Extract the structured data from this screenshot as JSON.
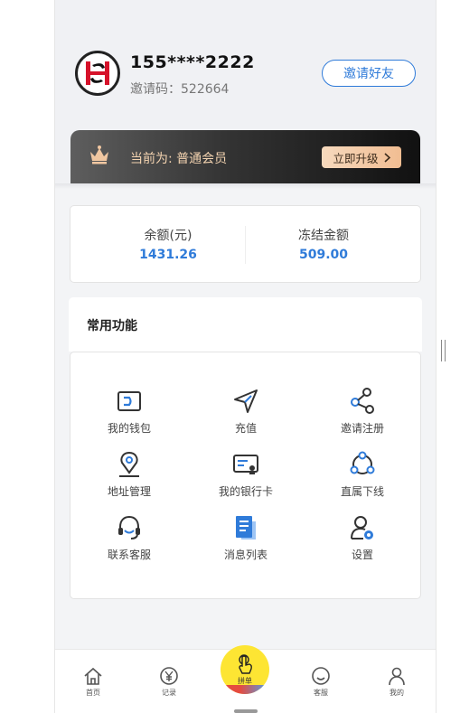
{
  "user": {
    "phone": "155****2222",
    "invite_label": "邀请码：",
    "invite_code": "522664",
    "invite_button": "邀请好友"
  },
  "vip": {
    "status": "当前为: 普通会员",
    "upgrade_button": "立即升级"
  },
  "balance": {
    "items": [
      {
        "label": "余额(元)",
        "value": "1431.26"
      },
      {
        "label": "冻结金额",
        "value": "509.00"
      }
    ]
  },
  "functions": {
    "title": "常用功能",
    "items": [
      {
        "label": "我的钱包",
        "icon": "wallet-icon"
      },
      {
        "label": "充值",
        "icon": "send-icon"
      },
      {
        "label": "邀请注册",
        "icon": "share-icon"
      },
      {
        "label": "地址管理",
        "icon": "location-pin-icon"
      },
      {
        "label": "我的银行卡",
        "icon": "bank-card-icon"
      },
      {
        "label": "直属下线",
        "icon": "network-icon"
      },
      {
        "label": "联系客服",
        "icon": "headset-icon"
      },
      {
        "label": "消息列表",
        "icon": "document-icon"
      },
      {
        "label": "设置",
        "icon": "user-settings-icon"
      }
    ]
  },
  "tabbar": {
    "items": [
      {
        "label": "首页",
        "icon": "home-icon"
      },
      {
        "label": "记录",
        "icon": "yen-icon"
      },
      {
        "label": "拼单",
        "icon": "tap-icon"
      },
      {
        "label": "客服",
        "icon": "smile-icon"
      },
      {
        "label": "我的",
        "icon": "person-icon"
      }
    ]
  },
  "colors": {
    "accent": "#2f7bd9",
    "vip_gold": "#f3d3b0",
    "center_button": "#fde533"
  }
}
